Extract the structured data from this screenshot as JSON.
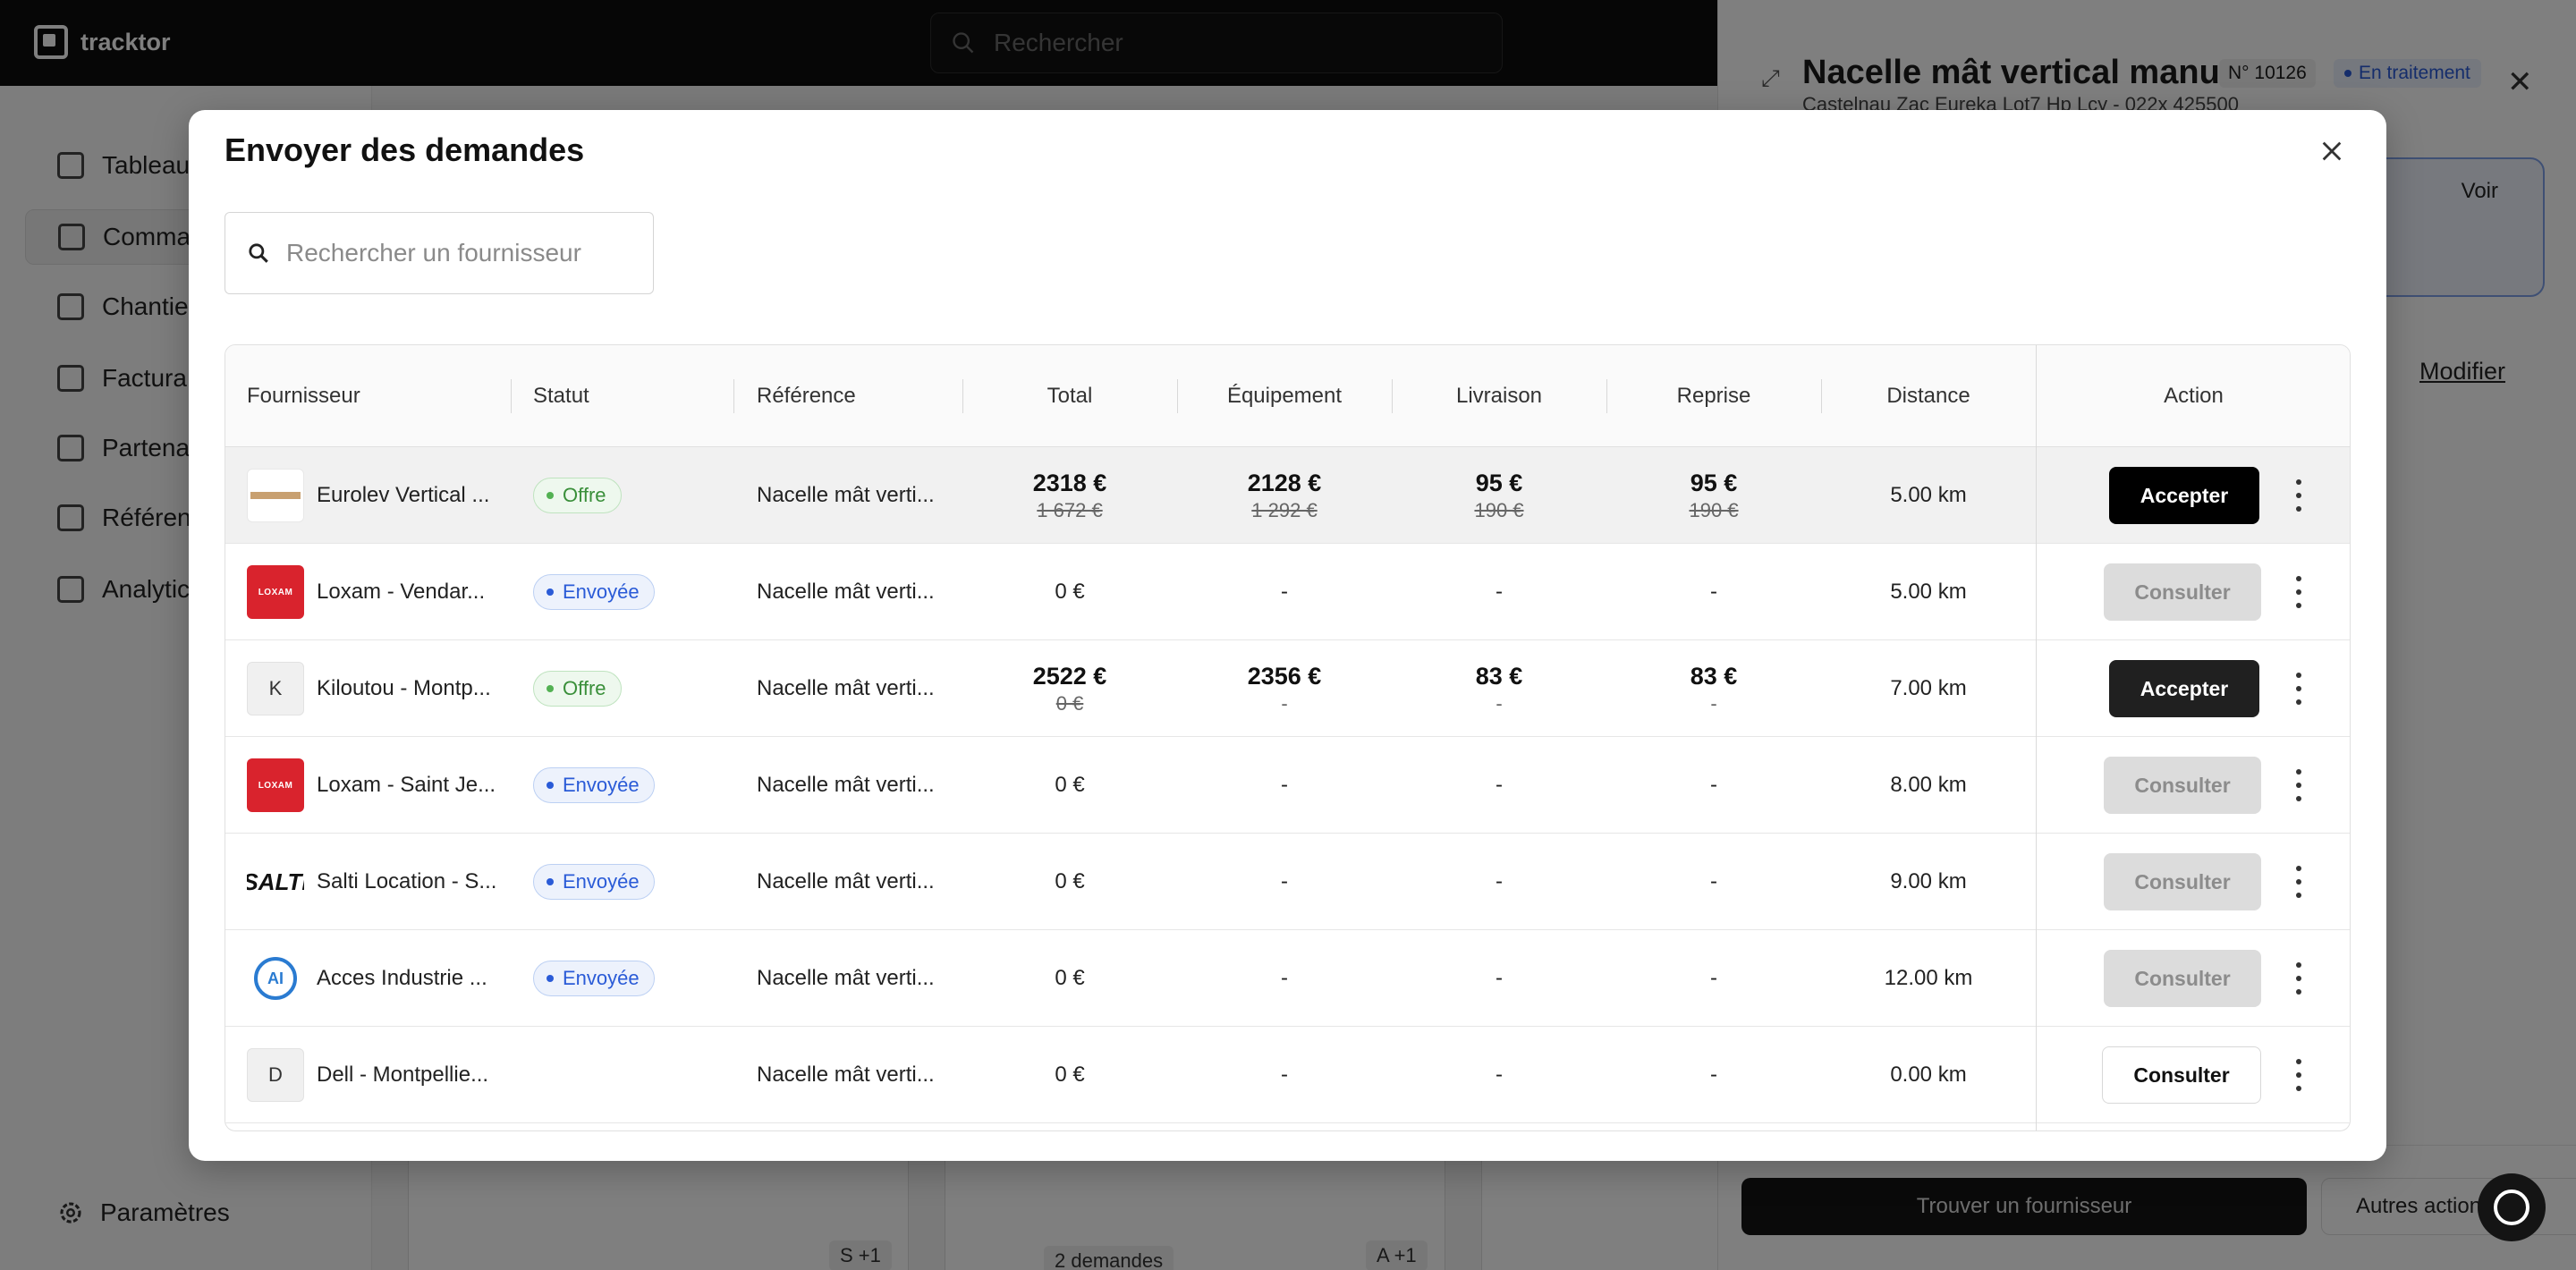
{
  "app": {
    "brand": "tracktor",
    "search_placeholder": "Rechercher",
    "settings_label": "Paramètres"
  },
  "sidebar": {
    "items": [
      {
        "label": "Tableau",
        "icon": "home-icon"
      },
      {
        "label": "Comma",
        "icon": "inbox-icon"
      },
      {
        "label": "Chantie",
        "icon": "building-icon"
      },
      {
        "label": "Factura",
        "icon": "document-icon"
      },
      {
        "label": "Partena",
        "icon": "contact-icon"
      },
      {
        "label": "Référen",
        "icon": "book-icon"
      },
      {
        "label": "Analytic",
        "icon": "chart-icon"
      }
    ]
  },
  "background": {
    "chip_left": "S +1",
    "chip_mid": "2 demandes",
    "chip_right": "A +1"
  },
  "drawer": {
    "title": "Nacelle mât vertical manu...",
    "subtitle": "Castelnau Zac Eureka Lot7 Hp Lcy - 022x 425500",
    "order_number": "N° 10126",
    "status": "En traitement",
    "voir_label": "Voir",
    "modifier_label": "Modifier",
    "find_button": "Trouver un fournisseur",
    "other_button": "Autres actions"
  },
  "modal": {
    "title": "Envoyer des demandes",
    "search_placeholder": "Rechercher un fournisseur",
    "columns": {
      "supplier": "Fournisseur",
      "status": "Statut",
      "reference": "Référence",
      "total": "Total",
      "equipment": "Équipement",
      "delivery": "Livraison",
      "pickup": "Reprise",
      "distance": "Distance",
      "action": "Action"
    },
    "rows": [
      {
        "supplier": "Eurolev Vertical ...",
        "logo": "eurolev",
        "status": "Offre",
        "reference": "Nacelle mât verti...",
        "total": "2318 €",
        "total_old": "1 672 €",
        "equipment": "2128 €",
        "equipment_old": "1 292 €",
        "delivery": "95 €",
        "delivery_old": "190 €",
        "pickup": "95 €",
        "pickup_old": "190 €",
        "distance": "5.00 km",
        "action": "Accepter"
      },
      {
        "supplier": "Loxam - Vendar...",
        "logo": "loxam",
        "status": "Envoyée",
        "reference": "Nacelle mât verti...",
        "total": "0 €",
        "equipment": "-",
        "delivery": "-",
        "pickup": "-",
        "distance": "5.00 km",
        "action": "Consulter"
      },
      {
        "supplier": "Kiloutou - Montp...",
        "logo": "K",
        "status": "Offre",
        "reference": "Nacelle mât verti...",
        "total": "2522 €",
        "total_old": "0 €",
        "equipment": "2356 €",
        "equipment_old": "-",
        "delivery": "83 €",
        "delivery_old": "-",
        "pickup": "83 €",
        "pickup_old": "-",
        "distance": "7.00 km",
        "action": "Accepter"
      },
      {
        "supplier": "Loxam - Saint Je...",
        "logo": "loxam",
        "status": "Envoyée",
        "reference": "Nacelle mât verti...",
        "total": "0 €",
        "equipment": "-",
        "delivery": "-",
        "pickup": "-",
        "distance": "8.00 km",
        "action": "Consulter"
      },
      {
        "supplier": "Salti Location - S...",
        "logo": "salti",
        "status": "Envoyée",
        "reference": "Nacelle mât verti...",
        "total": "0 €",
        "equipment": "-",
        "delivery": "-",
        "pickup": "-",
        "distance": "9.00 km",
        "action": "Consulter"
      },
      {
        "supplier": "Acces Industrie ...",
        "logo": "acces",
        "status": "Envoyée",
        "reference": "Nacelle mât verti...",
        "total": "0 €",
        "equipment": "-",
        "delivery": "-",
        "pickup": "-",
        "distance": "12.00 km",
        "action": "Consulter"
      },
      {
        "supplier": "Dell - Montpellie...",
        "logo": "D",
        "status": "",
        "reference": "Nacelle mât verti...",
        "total": "0 €",
        "equipment": "-",
        "delivery": "-",
        "pickup": "-",
        "distance": "0.00 km",
        "action": "Consulter"
      }
    ]
  },
  "logo_text": {
    "loxam": "LOXAM",
    "salti": "SALTI",
    "acces": "AI"
  },
  "colors": {
    "accent_blue": "#2a5bd7",
    "offer_green": "#3a8f3a",
    "loxam_red": "#d9232d"
  }
}
